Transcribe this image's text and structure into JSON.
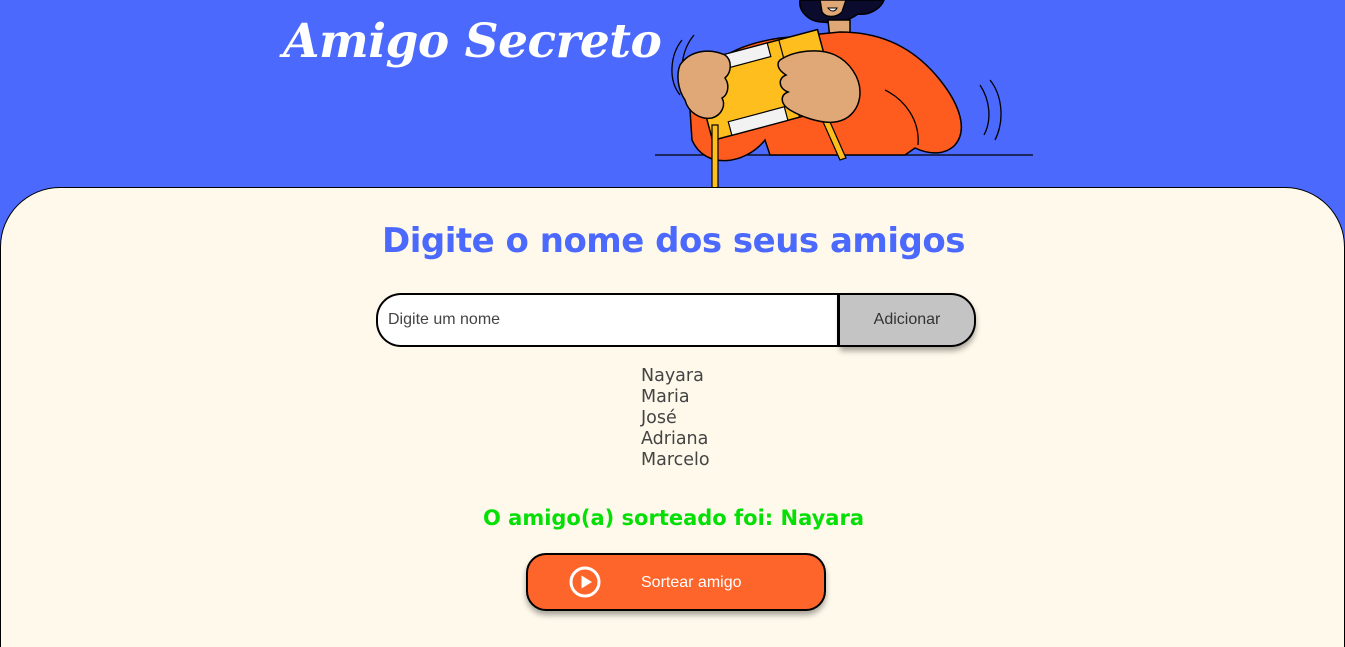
{
  "header": {
    "title": "Amigo Secreto"
  },
  "main": {
    "section_title": "Digite o nome dos seus amigos",
    "input_placeholder": "Digite um nome",
    "input_value": "",
    "add_button_label": "Adicionar",
    "friends": [
      "Nayara",
      "Maria",
      "José",
      "Adriana",
      "Marcelo"
    ],
    "result_text": "O amigo(a) sorteado foi: Nayara",
    "draw_button_label": "Sortear amigo",
    "draw_icon": "play-circle-icon"
  },
  "colors": {
    "header_bg": "#4b69fd",
    "main_bg": "#fff9eb",
    "accent_blue": "#4b69fd",
    "result_green": "#05df05",
    "draw_button_bg": "#fe652b",
    "add_button_bg": "#c4c4c4"
  }
}
